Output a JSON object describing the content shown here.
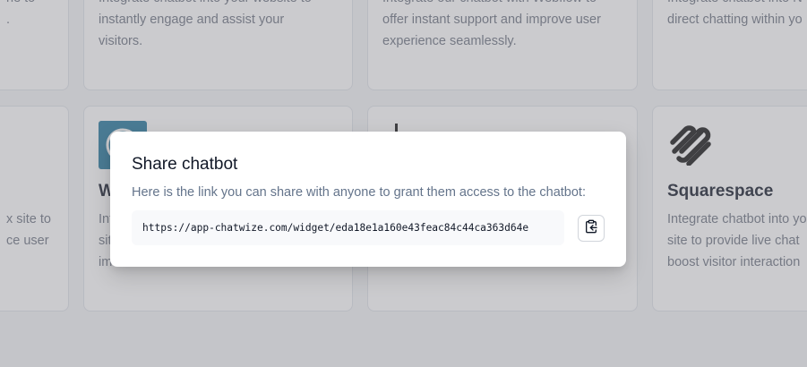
{
  "integrations": {
    "top_row": [
      {
        "desc_lines": [
          "ne to",
          "."
        ]
      },
      {
        "desc_lines": [
          "Integrate chatbot into your website to",
          "instantly engage and assist your",
          "visitors."
        ]
      },
      {
        "desc_lines": [
          "Integrate our chatbot with Webflow to",
          "offer instant support and improve user",
          "experience seamlessly."
        ]
      },
      {
        "desc_lines": [
          "Integrate chatbot into N",
          "direct chatting within yo"
        ]
      }
    ],
    "bottom_row": [
      {
        "desc_lines": [
          "x site to",
          "ce user",
          ""
        ]
      },
      {
        "title": "W",
        "desc_lines": [
          "Int",
          "sit",
          "im"
        ]
      },
      {
        "title": "",
        "desc_lines": [
          "",
          "",
          ""
        ]
      },
      {
        "title": "Squarespace",
        "desc_lines": [
          "Integrate chatbot into yo",
          "site to provide live chat",
          "boost visitor interaction"
        ]
      }
    ]
  },
  "modal": {
    "title": "Share chatbot",
    "description": "Here is the link you can share with anyone to grant them access to the chatbot:",
    "link": "https://app-chatwize.com/widget/eda18e1a160e43feac84c44ca363d64e",
    "copy_icon": "clipboard-copy-icon"
  },
  "colors": {
    "overlay": "rgba(130,132,138,0.42)",
    "wordpress_blue": "#21759b",
    "text_muted": "#64748b"
  }
}
